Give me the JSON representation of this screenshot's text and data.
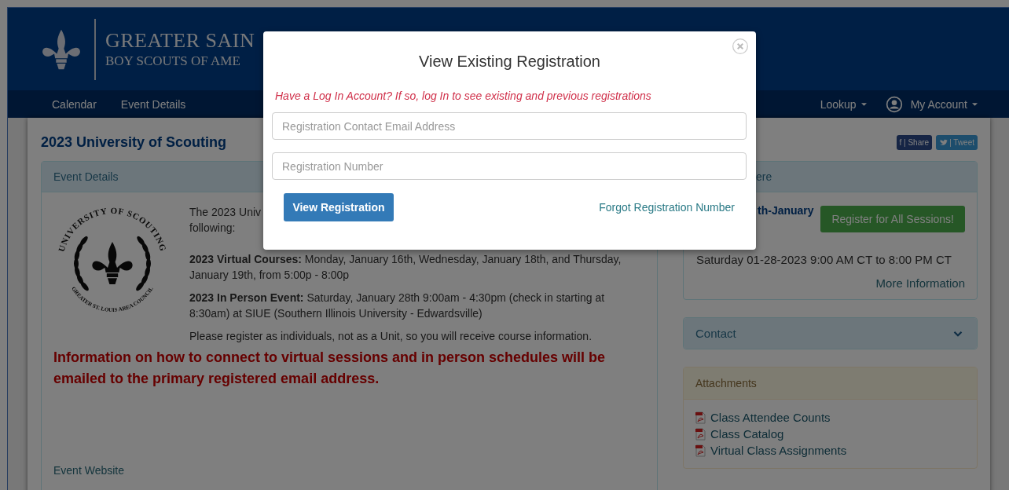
{
  "header": {
    "org_name": "GREATER SAIN",
    "org_subtitle": "BOY SCOUTS OF AME"
  },
  "nav": {
    "left": [
      {
        "label": "Calendar"
      },
      {
        "label": "Event Details"
      }
    ],
    "right": [
      {
        "label": "Lookup",
        "kind": "dropdown"
      },
      {
        "label": "My Account",
        "kind": "account"
      }
    ]
  },
  "event": {
    "title": "2023 University of Scouting",
    "share_buttons": [
      {
        "label": "f | Share",
        "kind": "facebook"
      },
      {
        "label": "| Tweet",
        "kind": "twitter"
      }
    ]
  },
  "details_panel": {
    "heading": "Event Details",
    "emblem": {
      "top_text": "UNIVERSITY OF SCOUTING",
      "bottom_text": "GREATER ST. LOUIS AREA COUNCIL"
    },
    "intro": [
      "The 2023 Univ",
      "following:"
    ],
    "paragraphs": [
      "**2023 Virtual Courses:** Monday, January 16th, Wednesday, January 18th, and Thursday, January 19th, from 5:00p - 8:00p",
      "**2023 In Person Event:** Saturday, January 28th 9:00am - 4:30pm (check in starting at 8:30am) at SIUE (Southern Illinois University - Edwardsville)",
      "Please register as individuals, not as a Unit, so you will receive course information."
    ],
    "notice": "Information on how to connect to virtual sessions and in person schedules will be emailed to the primary registered email address.",
    "website_link": "Event Website"
  },
  "sessions_panel": {
    "heading": "ere",
    "date_heading": "th-January",
    "register_button": "Register for All Sessions!",
    "time": "Saturday 01-28-2023 9:00 AM CT to 8:00 PM CT",
    "more_link": "More Information"
  },
  "contact_panel": {
    "heading": "Contact",
    "expanded": false
  },
  "attachments_panel": {
    "heading": "Attachments",
    "items": [
      "Class Attendee Counts",
      "Class Catalog",
      "Virtual Class Assignments"
    ]
  },
  "modal": {
    "title": "View Existing Registration",
    "message": "Have a Log In Account? If so, log In to see existing and previous registrations",
    "fields": [
      {
        "placeholder": "Registration Contact Email Address"
      },
      {
        "placeholder": "Registration Number"
      }
    ],
    "submit_button": "View Registration",
    "forgot_link": "Forgot Registration Number"
  }
}
